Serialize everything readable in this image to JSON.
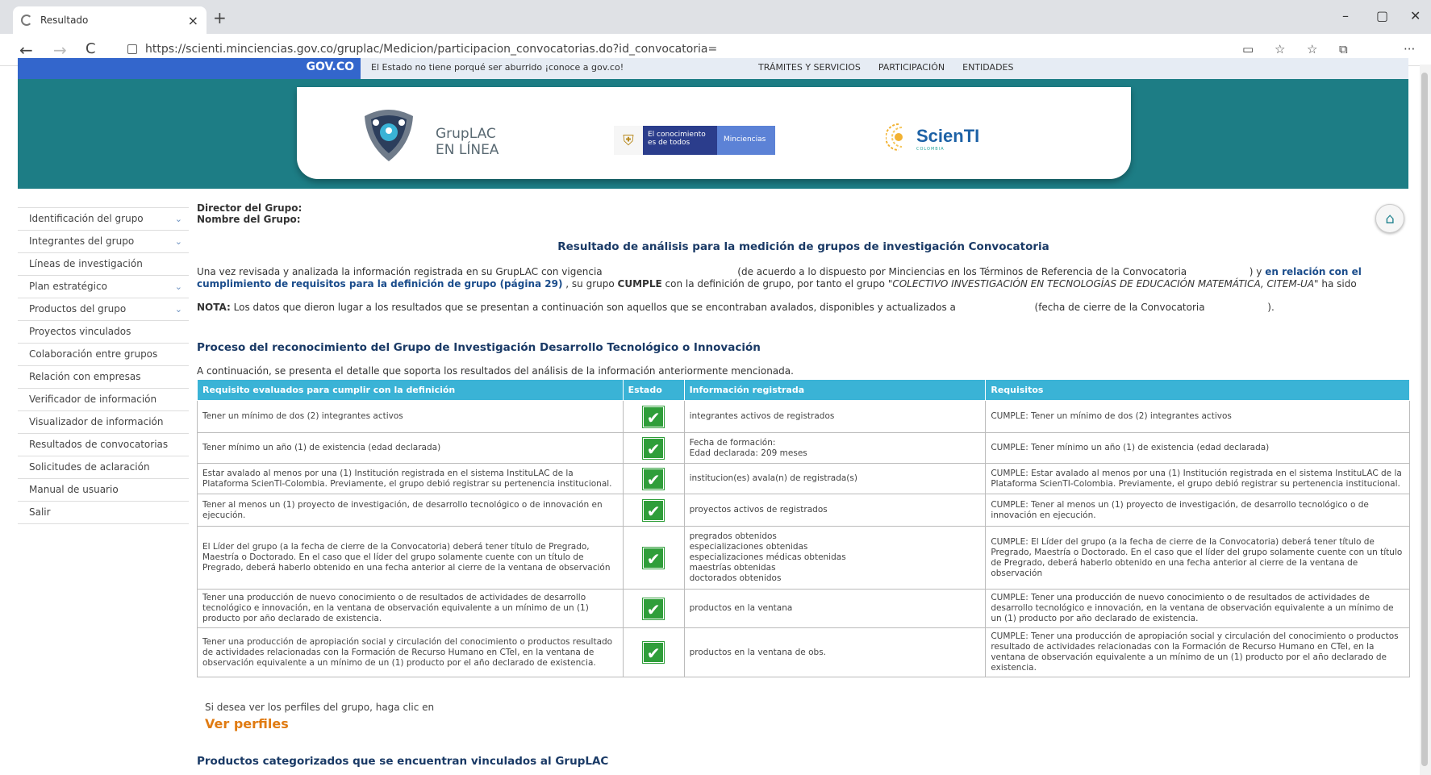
{
  "browser": {
    "tab_title": "Resultado",
    "tab_close": "×",
    "new_tab": "+",
    "url": "https://scienti.minciencias.gov.co/gruplac/Medicion/participacion_convocatorias.do?id_convocatoria=",
    "window_controls": [
      "–",
      "▢",
      "✕"
    ],
    "nav": [
      "←",
      "→",
      "C"
    ],
    "more": "···"
  },
  "govbar": {
    "logo": "GOV.CO",
    "tagline": "El Estado no tiene porqué ser aburrido ¡conoce a gov.co!",
    "links": [
      "TRÁMITES Y SERVICIOS",
      "PARTICIPACIÓN",
      "ENTIDADES"
    ]
  },
  "header": {
    "grup_line1": "GrupLAC",
    "grup_line2": "EN LÍNEA",
    "min_text1": "El conocimiento",
    "min_text2": "es de todos",
    "min_name": "Minciencias",
    "scienti": "ScienTI",
    "scienti_sub": "COLOMBIA"
  },
  "sidebar": {
    "items": [
      {
        "label": "Identificación del grupo",
        "chevron": true
      },
      {
        "label": "Integrantes del grupo",
        "chevron": true
      },
      {
        "label": "Líneas de investigación",
        "chevron": false
      },
      {
        "label": "Plan estratégico",
        "chevron": true
      },
      {
        "label": "Productos del grupo",
        "chevron": true
      },
      {
        "label": "Proyectos vinculados",
        "chevron": false
      },
      {
        "label": "Colaboración entre grupos",
        "chevron": false
      },
      {
        "label": "Relación con empresas",
        "chevron": false
      },
      {
        "label": "Verificador de información",
        "chevron": false
      },
      {
        "label": "Visualizador de información",
        "chevron": false
      },
      {
        "label": "Resultados de convocatorias",
        "chevron": false
      },
      {
        "label": "Solicitudes de aclaración",
        "chevron": false
      },
      {
        "label": "Manual de usuario",
        "chevron": false
      },
      {
        "label": "Salir",
        "chevron": false
      }
    ]
  },
  "main": {
    "director_label": "Director del Grupo:",
    "group_label": "Nombre del Grupo:",
    "result_title": "Resultado de análisis para la medición de grupos de investigación Convocatoria",
    "intro_a": "Una vez revisada y analizada la información registrada en su GrupLAC con vigencia",
    "intro_b": "(de acuerdo a lo dispuesto por Minciencias en los Términos de Referencia de la Convocatoria",
    "intro_c": ") y",
    "intro_link1": "en relación con el cumplimiento de",
    "intro_link2": "requisitos para la definición de grupo (página 29)",
    "intro_d": ", su grupo",
    "intro_cumple": "CUMPLE",
    "intro_e": "con la definición de grupo, por tanto el grupo",
    "intro_group": "\"COLECTIVO INVESTIGACIÓN EN TECNOLOGÍAS DE EDUCACIÓN MATEMÁTICA, CITEM-UA\"",
    "intro_f": "ha sido",
    "nota_label": "NOTA:",
    "nota_text": "Los datos que dieron lugar a los resultados que se presentan a continuación son aquellos que se encontraban avalados, disponibles y actualizados a",
    "nota_b": "(fecha de cierre de la Convocatoria",
    "nota_c": ").",
    "process_title": "Proceso del reconocimiento del Grupo de Investigación Desarrollo Tecnológico o Innovación",
    "detail_text": "A continuación, se presenta el detalle que soporta los resultados del análisis de la información anteriormente mencionada.",
    "table": {
      "headers": [
        "Requisito evaluados para cumplir con la definición",
        "Estado",
        "Información registrada",
        "Requisitos"
      ],
      "check": "✔",
      "rows": [
        {
          "req": "Tener un mínimo de dos (2) integrantes activos",
          "info": "integrantes activos de     registrados",
          "result": "CUMPLE: Tener un mínimo de dos (2) integrantes activos"
        },
        {
          "req": "Tener mínimo un año (1) de existencia (edad declarada)",
          "info": "Fecha de formación:\nEdad declarada: 209 meses",
          "result": "CUMPLE: Tener mínimo un año (1) de existencia (edad declarada)"
        },
        {
          "req": "Estar avalado al menos por una (1) Institución registrada en el sistema InstituLAC de la Plataforma ScienTI-Colombia. Previamente, el grupo debió registrar su pertenencia institucional.",
          "info": "institucion(es) avala(n) de     registrada(s)",
          "result": "CUMPLE: Estar avalado al menos por una (1) Institución registrada en el sistema InstituLAC de la Plataforma ScienTI-Colombia. Previamente, el grupo debió registrar su pertenencia institucional."
        },
        {
          "req": "Tener al menos un (1) proyecto de investigación, de desarrollo tecnológico o de innovación en ejecución.",
          "info": "proyectos activos de     registrados",
          "result": "CUMPLE: Tener al menos un (1) proyecto de investigación, de desarrollo tecnológico o de innovación en ejecución."
        },
        {
          "req": "El Líder del grupo (a la fecha de cierre de la Convocatoria) deberá tener título de Pregrado, Maestría o Doctorado. En el caso que el líder del grupo solamente cuente con un título de Pregrado, deberá haberlo obtenido en una fecha anterior al cierre de la ventana de observación",
          "info": "pregrados obtenidos\nespecializaciones obtenidas\nespecializaciones médicas obtenidas\nmaestrías obtenidas\ndoctorados obtenidos",
          "result": "CUMPLE: El Líder del grupo (a la fecha de cierre de la Convocatoria) deberá tener título de Pregrado, Maestría o Doctorado. En el caso que el líder del grupo solamente cuente con un título de Pregrado, deberá haberlo obtenido en una fecha anterior al cierre de la ventana de observación"
        },
        {
          "req": "Tener una producción de nuevo conocimiento o de resultados de actividades de desarrollo tecnológico e innovación, en la ventana de observación equivalente a un mínimo de un (1) producto por año declarado de existencia.",
          "info": "productos en la ventana",
          "result": "CUMPLE: Tener una producción de nuevo conocimiento o de resultados de actividades de desarrollo tecnológico e innovación, en la ventana de observación equivalente a un mínimo de un (1) producto por año declarado de existencia."
        },
        {
          "req": "Tener una producción de apropiación social y circulación del conocimiento o productos resultado de actividades relacionadas con la Formación de Recurso Humano en CTeI, en la ventana de observación equivalente a un mínimo de un (1) producto por el año declarado de existencia.",
          "info": "productos en la ventana de obs.",
          "result": "CUMPLE: Tener una producción de apropiación social y circulación del conocimiento o productos resultado de actividades relacionadas con la Formación de Recurso Humano en CTeI, en la ventana de observación equivalente a un mínimo de un (1) producto por el año declarado de existencia."
        }
      ]
    },
    "profiles_text": "Si desea ver los perfiles del grupo, haga clic en",
    "profiles_link": "Ver perfiles",
    "products_title": "Productos categorizados que se encuentran vinculados al GrupLAC"
  },
  "colors": {
    "teal": "#1d7d85",
    "gov_blue": "#3366cc",
    "table_header": "#3ab3d6",
    "check_green": "#2f9e3a",
    "link_orange": "#e07b12"
  }
}
